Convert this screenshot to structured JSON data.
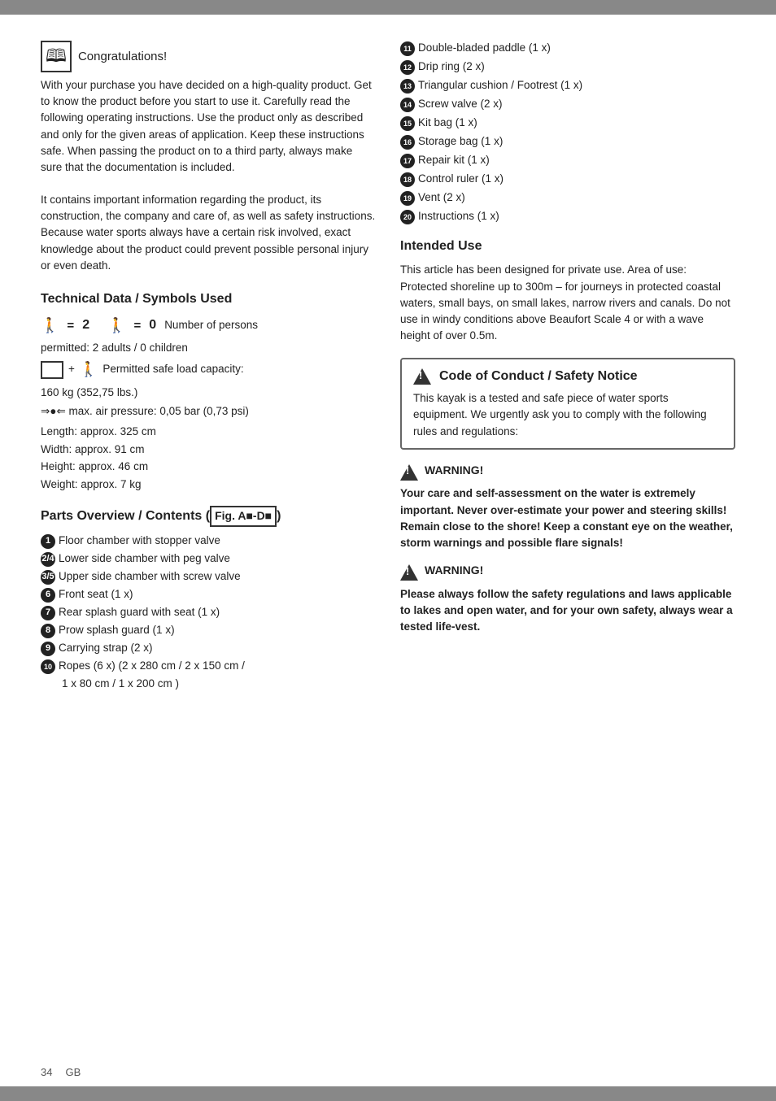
{
  "page": {
    "page_number": "34",
    "language": "GB"
  },
  "intro": {
    "title": "Congratulations!",
    "body1": "With your purchase you have decided on a high-quality product. Get to know the product before you start to use it. Carefully read the following operating instructions. Use the product only as described and only for the given areas of application. Keep these instructions safe. When passing the product on to a third party, always make sure that the documentation is included.",
    "body2": "It contains important information regarding the product, its construction, the company and care of, as well as safety instructions. Because water sports always have a certain risk involved, exact knowledge about the product could prevent possible personal injury or even death."
  },
  "technical_data": {
    "title": "Technical Data / Symbols Used",
    "persons_label": "Number of persons",
    "adults_num": "2",
    "children_num": "0",
    "permitted_line": "permitted: 2 adults / 0 children",
    "load_label": "Permitted safe load capacity:",
    "load_value": "160 kg (352,75 lbs.)",
    "air_pressure": "max. air pressure: 0,05 bar (0,73 psi)",
    "length": "Length: approx. 325 cm",
    "width": "Width: approx. 91 cm",
    "height": "Height: approx. 46 cm",
    "weight": "Weight: approx. 7 kg"
  },
  "parts_overview": {
    "title": "Parts Overview / Contents",
    "fig_label": "Fig.",
    "fig_range": "A - D",
    "items": [
      {
        "num": "1",
        "text": "Floor chamber with stopper valve"
      },
      {
        "num": "2/4",
        "text": "Lower side chamber with peg valve"
      },
      {
        "num": "3/5",
        "text": "Upper side chamber with screw valve"
      },
      {
        "num": "6",
        "text": "Front seat (1 x)"
      },
      {
        "num": "7",
        "text": "Rear splash guard with seat (1 x)"
      },
      {
        "num": "8",
        "text": "Prow splash guard (1 x)"
      },
      {
        "num": "9",
        "text": "Carrying strap (2 x)"
      },
      {
        "num": "10",
        "text": "Ropes (6 x) (2 x 280 cm / 2 x 150 cm / 1 x 80 cm / 1 x 200 cm )"
      }
    ]
  },
  "right_list": {
    "items": [
      {
        "num": "11",
        "text": "Double-bladed paddle (1 x)"
      },
      {
        "num": "12",
        "text": "Drip ring (2 x)"
      },
      {
        "num": "13",
        "text": "Triangular cushion / Footrest (1 x)"
      },
      {
        "num": "14",
        "text": "Screw valve (2 x)"
      },
      {
        "num": "15",
        "text": "Kit bag (1 x)"
      },
      {
        "num": "16",
        "text": "Storage bag (1 x)"
      },
      {
        "num": "17",
        "text": "Repair kit (1 x)"
      },
      {
        "num": "18",
        "text": "Control ruler (1 x)"
      },
      {
        "num": "19",
        "text": "Vent (2 x)"
      },
      {
        "num": "20",
        "text": "Instructions (1 x)"
      }
    ]
  },
  "intended_use": {
    "title": "Intended Use",
    "text": "This article has been designed for private use. Area of use: Protected shoreline up to 300m – for journeys in protected coastal waters, small bays, on small lakes, narrow rivers and canals. Do not use in windy conditions above Beaufort Scale 4 or with a wave height of over 0.5m."
  },
  "code_of_conduct": {
    "title": "Code of Conduct / Safety Notice",
    "text": "This kayak is a tested and safe piece of water sports equipment. We urgently ask you to comply with the following rules and regulations:"
  },
  "warnings": [
    {
      "label": "WARNING!",
      "text": "Your care and self-assessment on the water is extremely important. Never over-estimate your power and steering skills! Remain close to the shore! Keep a constant eye on the weather, storm warnings and possible flare signals!"
    },
    {
      "label": "WARNING!",
      "text": "Please always follow the safety regulations and laws applicable to lakes and open water, and for your own safety, always wear a tested life-vest."
    }
  ]
}
